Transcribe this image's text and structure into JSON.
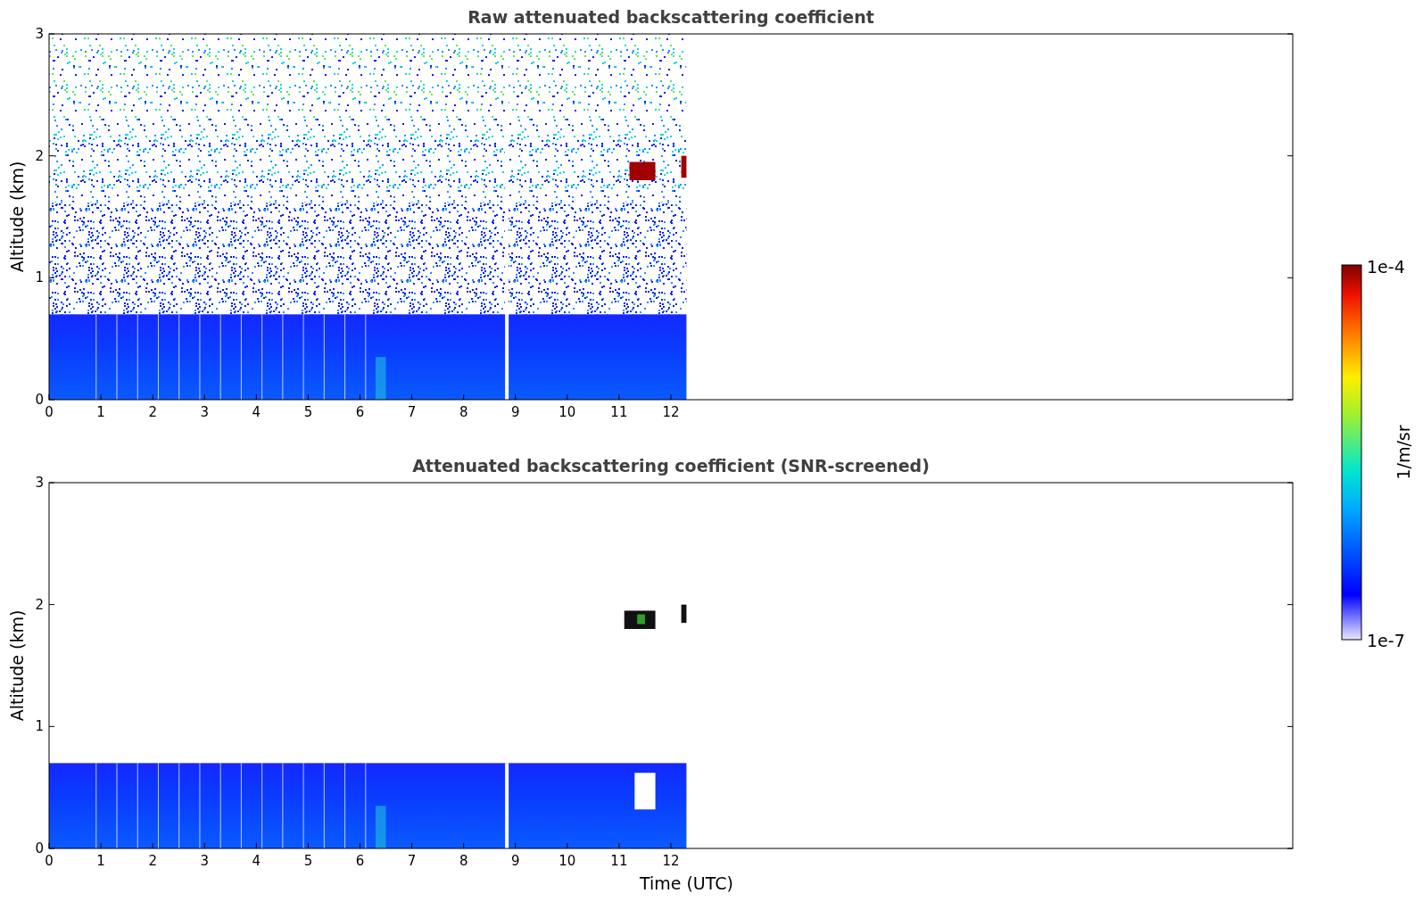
{
  "panels": [
    {
      "kind": "raw",
      "title": "Raw attenuated backscattering coefficient",
      "ylabel": "Altitude (km)",
      "yticks": [
        "3",
        "2",
        "1",
        "0"
      ],
      "xticks": [
        "0",
        "1",
        "2",
        "3",
        "4",
        "5",
        "6",
        "7",
        "8",
        "9",
        "10",
        "11",
        "12"
      ]
    },
    {
      "kind": "screened",
      "title": "Attenuated backscattering coefficient (SNR-screened)",
      "ylabel": "Altitude (km)",
      "yticks": [
        "3",
        "2",
        "1",
        "0"
      ],
      "xticks": [
        "0",
        "1",
        "2",
        "3",
        "4",
        "5",
        "6",
        "7",
        "8",
        "9",
        "10",
        "11",
        "12"
      ],
      "xlabel": "Time (UTC)"
    }
  ],
  "colorbar": {
    "label": "1/m/sr",
    "max_label": "1e-4",
    "min_label": "1e-7"
  }
}
